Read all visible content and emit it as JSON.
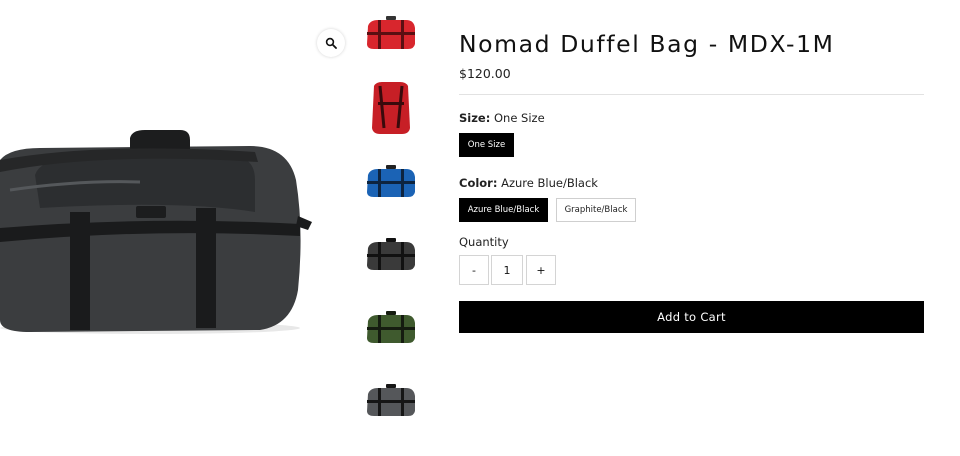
{
  "product": {
    "title": "Nomad Duffel Bag - MDX-1M",
    "price": "$120.00"
  },
  "gallery": {
    "zoom_icon": "magnifier-icon",
    "main_image_color": "#3b3d3f",
    "thumbnails": [
      {
        "name": "red-duffel-front",
        "color": "#d8262d"
      },
      {
        "name": "red-duffel-back",
        "color": "#c71f26"
      },
      {
        "name": "azure-blue-duffel",
        "color": "#1b63b5"
      },
      {
        "name": "black-duffel",
        "color": "#3a3a3a"
      },
      {
        "name": "green-duffel",
        "color": "#3f5a2e"
      },
      {
        "name": "graphite-duffel",
        "color": "#55575a"
      }
    ]
  },
  "options": {
    "size": {
      "label": "Size:",
      "value": "One Size",
      "choices": [
        "One Size"
      ]
    },
    "color": {
      "label": "Color:",
      "value": "Azure Blue/Black",
      "choices": [
        "Azure Blue/Black",
        "Graphite/Black"
      ]
    }
  },
  "quantity": {
    "label": "Quantity",
    "minus": "-",
    "value": "1",
    "plus": "+"
  },
  "cart": {
    "button_label": "Add to Cart"
  },
  "colors": {
    "accent": "#000000",
    "selected_text": "#ffffff"
  }
}
